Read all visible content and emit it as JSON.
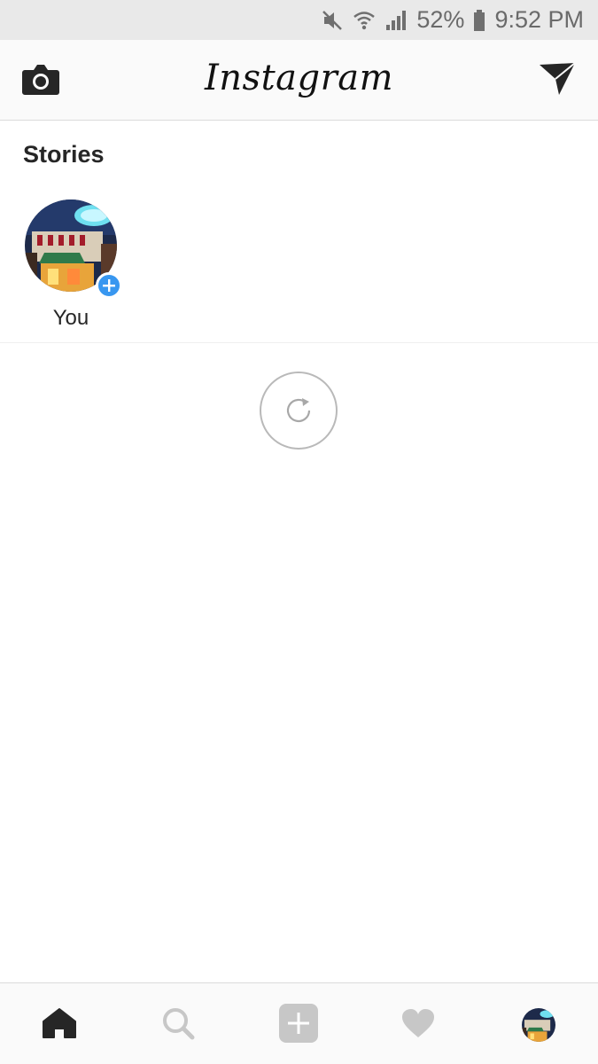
{
  "status_bar": {
    "battery_percent": "52%",
    "time": "9:52 PM",
    "icons": [
      "mute-icon",
      "wifi-icon",
      "signal-icon",
      "battery-icon"
    ]
  },
  "header": {
    "logo_text": "Instagram",
    "left_icon": "camera-icon",
    "right_icon": "direct-message-icon"
  },
  "stories": {
    "title": "Stories",
    "items": [
      {
        "label": "You",
        "badge_icon": "add-story-icon"
      }
    ]
  },
  "feed": {
    "reload_icon": "reload-icon"
  },
  "bottom_nav": {
    "items": [
      "home-icon",
      "search-icon",
      "add-post-icon",
      "heart-icon",
      "profile-avatar"
    ]
  },
  "colors": {
    "accent": "#3897f0",
    "status_bar_bg": "#e9e9e9",
    "header_bg": "#fafafa",
    "icon_dark": "#262626",
    "icon_muted": "#c7c7c7"
  }
}
